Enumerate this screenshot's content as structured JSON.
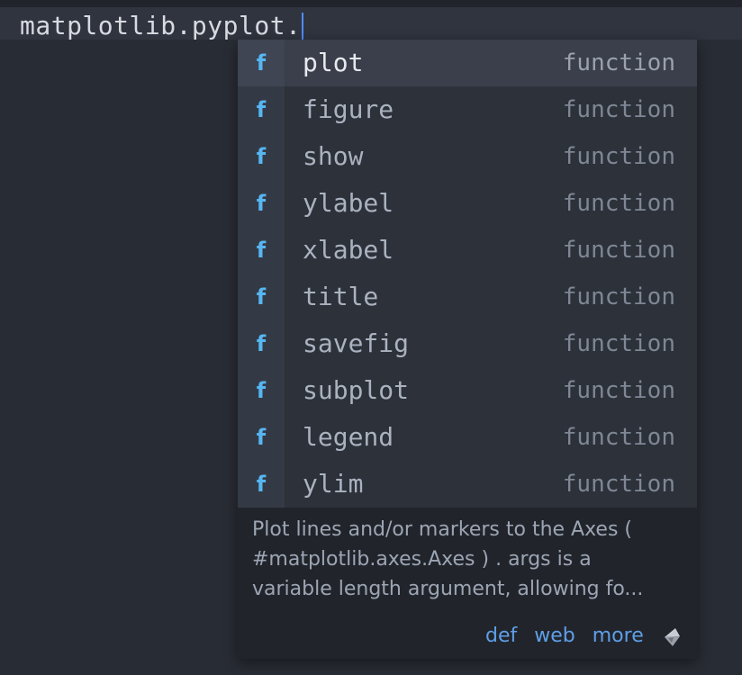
{
  "editor": {
    "line_text": "matplotlib.pyplot."
  },
  "completions": [
    {
      "name": "plot",
      "kind": "function",
      "icon": "f",
      "selected": true
    },
    {
      "name": "figure",
      "kind": "function",
      "icon": "f"
    },
    {
      "name": "show",
      "kind": "function",
      "icon": "f"
    },
    {
      "name": "ylabel",
      "kind": "function",
      "icon": "f"
    },
    {
      "name": "xlabel",
      "kind": "function",
      "icon": "f"
    },
    {
      "name": "title",
      "kind": "function",
      "icon": "f"
    },
    {
      "name": "savefig",
      "kind": "function",
      "icon": "f"
    },
    {
      "name": "subplot",
      "kind": "function",
      "icon": "f"
    },
    {
      "name": "legend",
      "kind": "function",
      "icon": "f"
    },
    {
      "name": "ylim",
      "kind": "function",
      "icon": "f"
    }
  ],
  "docs": {
    "lines": [
      "Plot lines and/or markers to the Axes (",
      "#matplotlib.axes.Axes ) . args is a",
      "variable length argument, allowing fo..."
    ]
  },
  "links": {
    "def": "def",
    "web": "web",
    "more": "more"
  },
  "icons": {
    "function_icon": "function-icon",
    "logo": "kite-logo-icon"
  },
  "colors": {
    "background": "#282c34",
    "icon_accent": "#56b6f2",
    "link": "#5f9fe8"
  }
}
